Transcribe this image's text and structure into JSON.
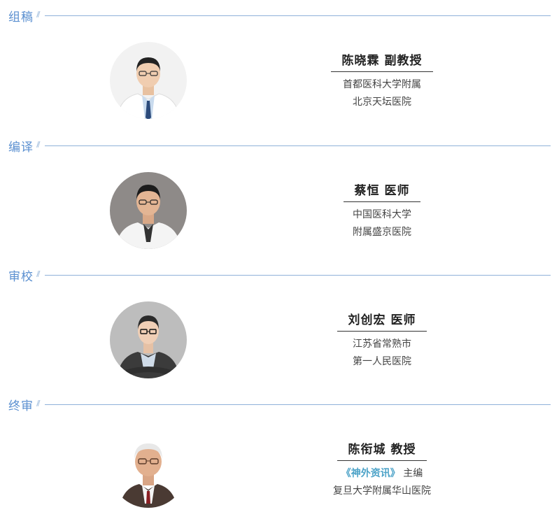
{
  "sections": [
    {
      "title": "组稿",
      "name": "陈晓霖 副教授",
      "aff_line1": "首都医科大学附属",
      "aff_line2": "北京天坛医院"
    },
    {
      "title": "编译",
      "name": "蔡恒 医师",
      "aff_line1": "中国医科大学",
      "aff_line2": "附属盛京医院"
    },
    {
      "title": "审校",
      "name": "刘创宏 医师",
      "aff_line1": "江苏省常熟市",
      "aff_line2": "第一人民医院"
    },
    {
      "title": "终审",
      "name": "陈衔城 教授",
      "aff_pub": "《神外资讯》",
      "aff_role": "主编",
      "aff_line2": "复旦大学附属华山医院"
    }
  ],
  "colors": {
    "section_title": "#5a8fd0",
    "rule": "#8fb1d9",
    "publication": "#4da3c8"
  }
}
